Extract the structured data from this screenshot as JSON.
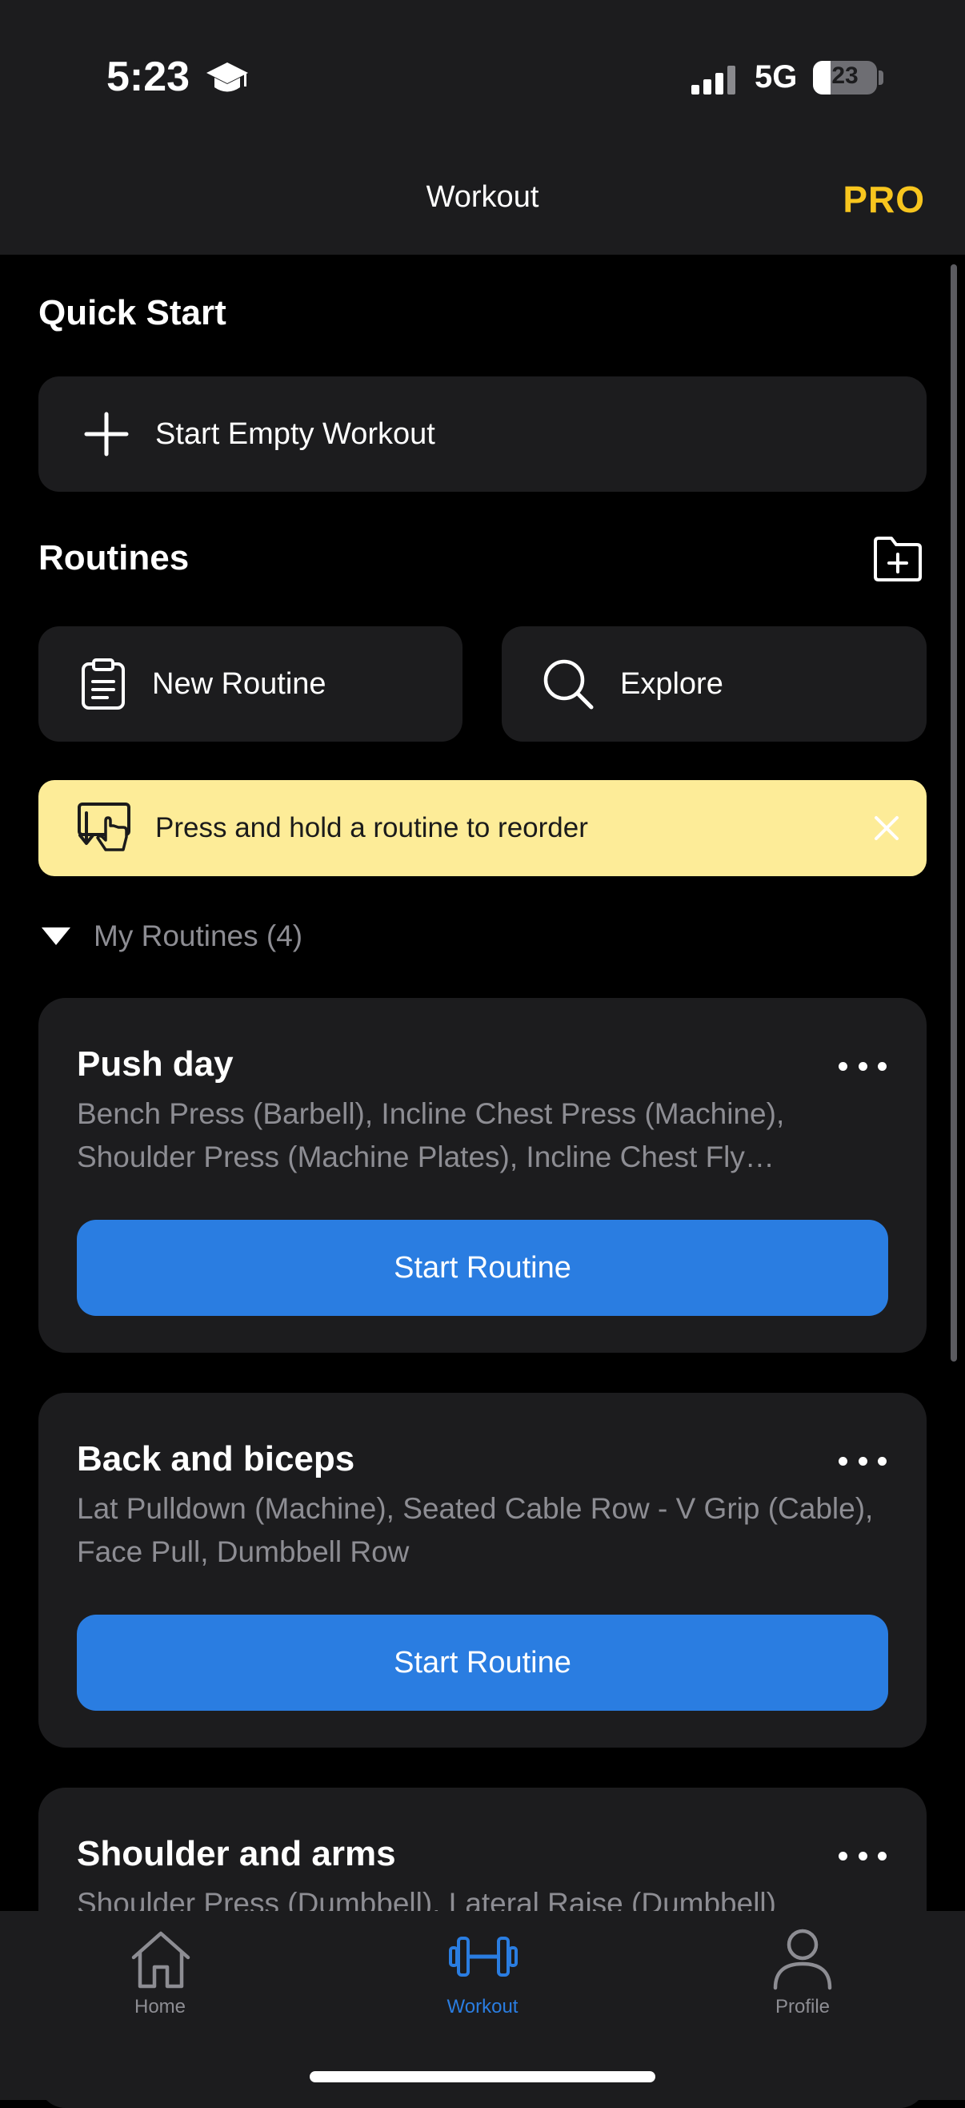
{
  "status": {
    "time": "5:23",
    "network": "5G",
    "battery": "23"
  },
  "header": {
    "title": "Workout",
    "pro_label": "PRO"
  },
  "quick_start": {
    "title": "Quick Start",
    "start_empty_label": "Start Empty Workout"
  },
  "routines": {
    "title": "Routines",
    "new_routine_label": "New Routine",
    "explore_label": "Explore",
    "banner_text": "Press and hold a routine to reorder",
    "my_routines_label": "My Routines (4)",
    "items": [
      {
        "name": "Push day",
        "description": "Bench Press (Barbell), Incline Chest Press (Machine), Shoulder Press (Machine Plates), Incline Chest Fly (Dumbbell)",
        "button_label": "Start Routine"
      },
      {
        "name": "Back and biceps",
        "description": "Lat Pulldown (Machine), Seated Cable Row - V Grip (Cable), Face Pull, Dumbbell Row",
        "button_label": "Start Routine"
      },
      {
        "name": "Shoulder and arms",
        "description": "Shoulder Press (Dumbbell), Lateral Raise (Dumbbell)"
      }
    ]
  },
  "tabbar": {
    "items": [
      {
        "label": "Home",
        "icon": "home-icon",
        "active": false
      },
      {
        "label": "Workout",
        "icon": "dumbbell-icon",
        "active": true
      },
      {
        "label": "Profile",
        "icon": "profile-icon",
        "active": false
      }
    ]
  },
  "colors": {
    "accent": "#2a7de1",
    "pro": "#f7c51e",
    "banner": "#fdec98",
    "card": "#1c1c1e"
  }
}
